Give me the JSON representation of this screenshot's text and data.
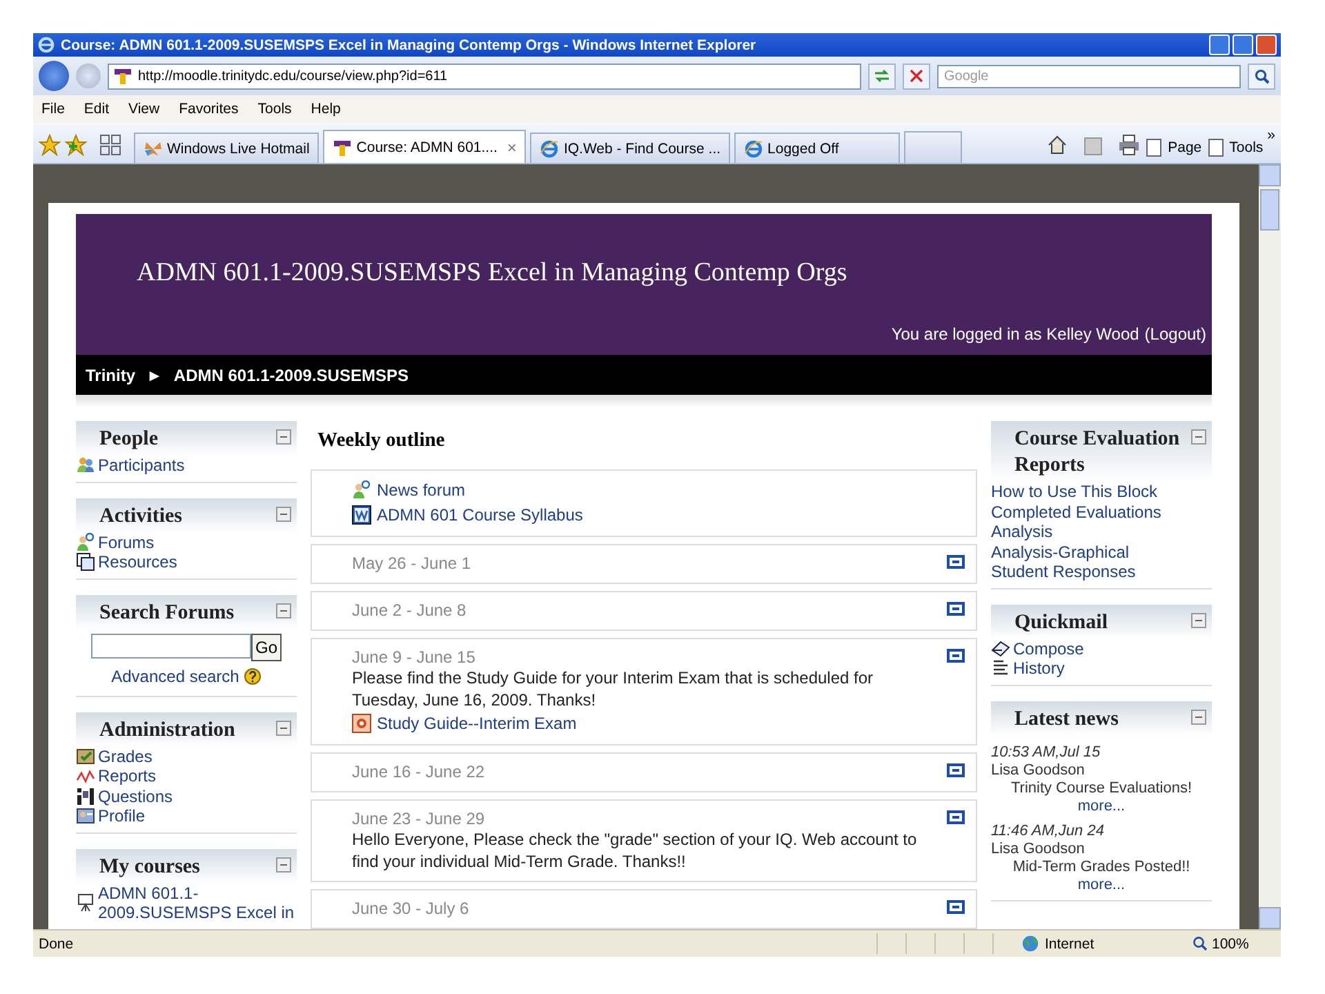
{
  "browser": {
    "title": "Course: ADMN 601.1-2009.SUSEMSPS Excel in Managing Contemp Orgs - Windows Internet Explorer",
    "address": "http://moodle.trinitydc.edu/course/view.php?id=611",
    "search": {
      "placeholder": "Google"
    },
    "menu": [
      "File",
      "Edit",
      "View",
      "Favorites",
      "Tools",
      "Help"
    ],
    "tabs": [
      {
        "label": "Windows Live Hotmail",
        "selected": false,
        "kind": "live"
      },
      {
        "label": "Course: ADMN 601....",
        "selected": true,
        "kind": "moodle",
        "close": "×"
      },
      {
        "label": "IQ.Web - Find Course ...",
        "selected": false,
        "kind": "ie"
      },
      {
        "label": "Logged Off",
        "selected": false,
        "kind": "ie"
      }
    ],
    "commands": [
      "Page",
      "Tools"
    ],
    "more": "»"
  },
  "page": {
    "header": {
      "title": "ADMN 601.1-2009.SUSEMSPS Excel in Managing Contemp Orgs",
      "login": "You are logged in as Kelley Wood",
      "logout": "(Logout)"
    },
    "breadcrumb": {
      "items": [
        "Trinity",
        "ADMN 601.1-2009.SUSEMSPS"
      ],
      "separator": "►"
    },
    "left_blocks": [
      {
        "kind": "links",
        "title": "People",
        "items": [
          {
            "label": "Participants",
            "kind": "people"
          }
        ]
      },
      {
        "kind": "links",
        "title": "Activities",
        "items": [
          {
            "label": "Forums",
            "kind": "forum"
          },
          {
            "label": "Resources",
            "kind": "resource"
          }
        ]
      },
      {
        "kind": "search",
        "title": "Search Forums",
        "button": "Go",
        "link": "Advanced search"
      },
      {
        "kind": "links",
        "title": "Administration",
        "items": [
          {
            "label": "Grades",
            "kind": "grades"
          },
          {
            "label": "Reports",
            "kind": "reports"
          },
          {
            "label": "Questions",
            "kind": "questions"
          },
          {
            "label": "Profile",
            "kind": "profile"
          }
        ]
      },
      {
        "kind": "links",
        "title": "My courses",
        "items": [
          {
            "label": "ADMN 601.1-2009.SUSEMSPS Excel in",
            "kind": "course"
          }
        ]
      }
    ],
    "outline": {
      "title": "Weekly outline",
      "sections": [
        {
          "items": [
            {
              "label": "News forum",
              "kind": "forum"
            },
            {
              "label": "ADMN 601 Course Syllabus",
              "kind": "word"
            }
          ]
        },
        {
          "week": "May 26 - June 1"
        },
        {
          "week": "June 2 - June 8"
        },
        {
          "week": "June 9 - June 15",
          "summary": "Please find the Study Guide for your Interim Exam that is scheduled for Tuesday, June 16, 2009. Thanks!",
          "items": [
            {
              "label": "Study Guide--Interim Exam",
              "kind": "slides"
            }
          ]
        },
        {
          "week": "June 16 - June 22"
        },
        {
          "week": "June 23 - June 29",
          "summary": "Hello Everyone, Please check the \"grade\" section of your IQ. Web account to find your individual Mid-Term Grade. Thanks!!"
        },
        {
          "week": "June 30 - July 6"
        }
      ]
    },
    "right_blocks": [
      {
        "kind": "links",
        "title": "Course Evaluation Reports",
        "items": [
          {
            "label": "How to Use This Block",
            "kind": "none"
          },
          {
            "label": "Completed Evaluations",
            "kind": "none"
          },
          {
            "label": "Analysis",
            "kind": "none"
          },
          {
            "label": "Analysis-Graphical",
            "kind": "none"
          },
          {
            "label": "Student Responses",
            "kind": "none"
          }
        ]
      },
      {
        "kind": "links",
        "title": "Quickmail",
        "items": [
          {
            "label": "Compose",
            "kind": "compose"
          },
          {
            "label": "History",
            "kind": "history"
          }
        ]
      },
      {
        "kind": "news",
        "title": "Latest news",
        "posts": [
          {
            "time": "10:53 AM,Jul 15",
            "author": "Lisa Goodson",
            "text": "Trinity Course Evaluations!",
            "more": "more..."
          },
          {
            "time": "11:46 AM,Jun 24",
            "author": "Lisa Goodson",
            "text": "Mid-Term Grades Posted!!",
            "more": "more..."
          }
        ]
      }
    ]
  },
  "status_bar": {
    "text": "Done",
    "zone": "Internet",
    "zoom": "100%"
  }
}
